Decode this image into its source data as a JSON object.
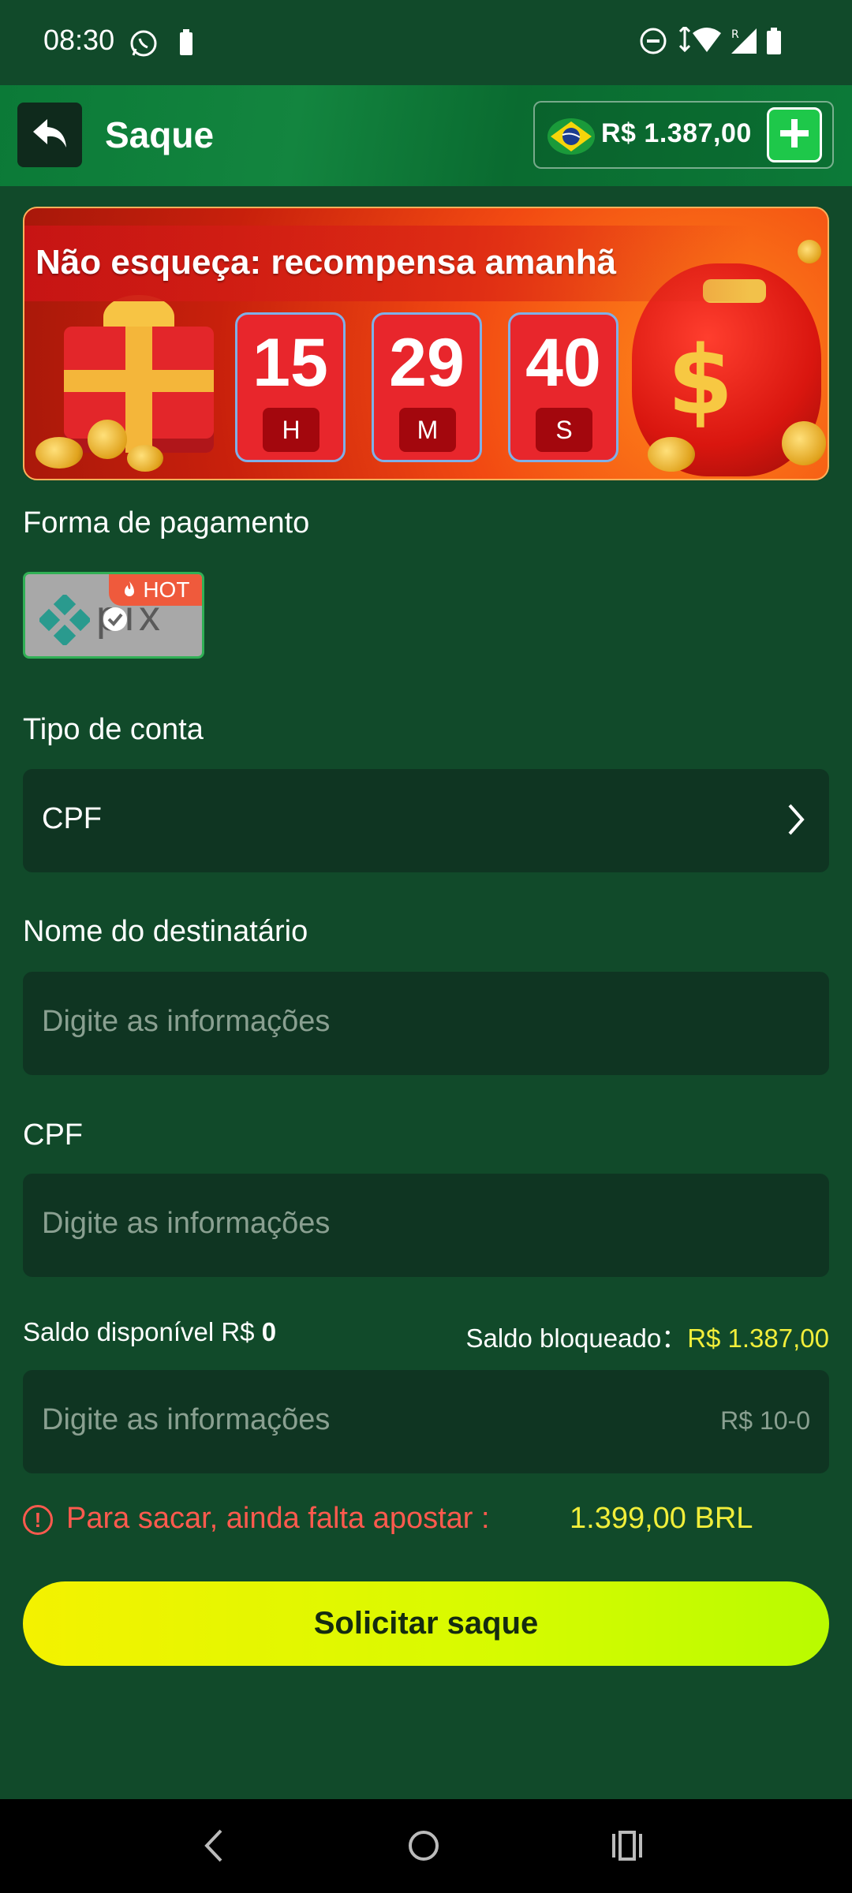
{
  "status_bar": {
    "time": "08:30"
  },
  "header": {
    "title": "Saque",
    "balance": "R$ 1.387,00"
  },
  "banner": {
    "title": "Não esqueça: recompensa amanhã",
    "timer": [
      {
        "value": "15",
        "unit": "H"
      },
      {
        "value": "29",
        "unit": "M"
      },
      {
        "value": "40",
        "unit": "S"
      }
    ]
  },
  "payment": {
    "label": "Forma de pagamento",
    "method": "pix",
    "badge": "HOT"
  },
  "account_type": {
    "label": "Tipo de conta",
    "value": "CPF"
  },
  "recipient": {
    "label": "Nome do destinatário",
    "placeholder": "Digite as informações"
  },
  "cpf": {
    "label": "CPF",
    "placeholder": "Digite as informações"
  },
  "balance_info": {
    "available_label": "Saldo disponível R$",
    "available_value": "0",
    "blocked_label": "Saldo bloqueado：",
    "blocked_value": "R$ 1.387,00"
  },
  "amount": {
    "placeholder": "Digite as informações",
    "range": "R$ 10-0"
  },
  "warning": {
    "text": "Para sacar, ainda falta apostar :",
    "value": "1.399,00 BRL"
  },
  "submit": {
    "label": "Solicitar saque"
  },
  "colors": {
    "background": "#114a2a",
    "header": "#0b7a37",
    "field": "#0f3522",
    "accent_yellow": "#f1ee3a",
    "warning_red": "#ff5a4e",
    "button": "#e8fa00"
  }
}
